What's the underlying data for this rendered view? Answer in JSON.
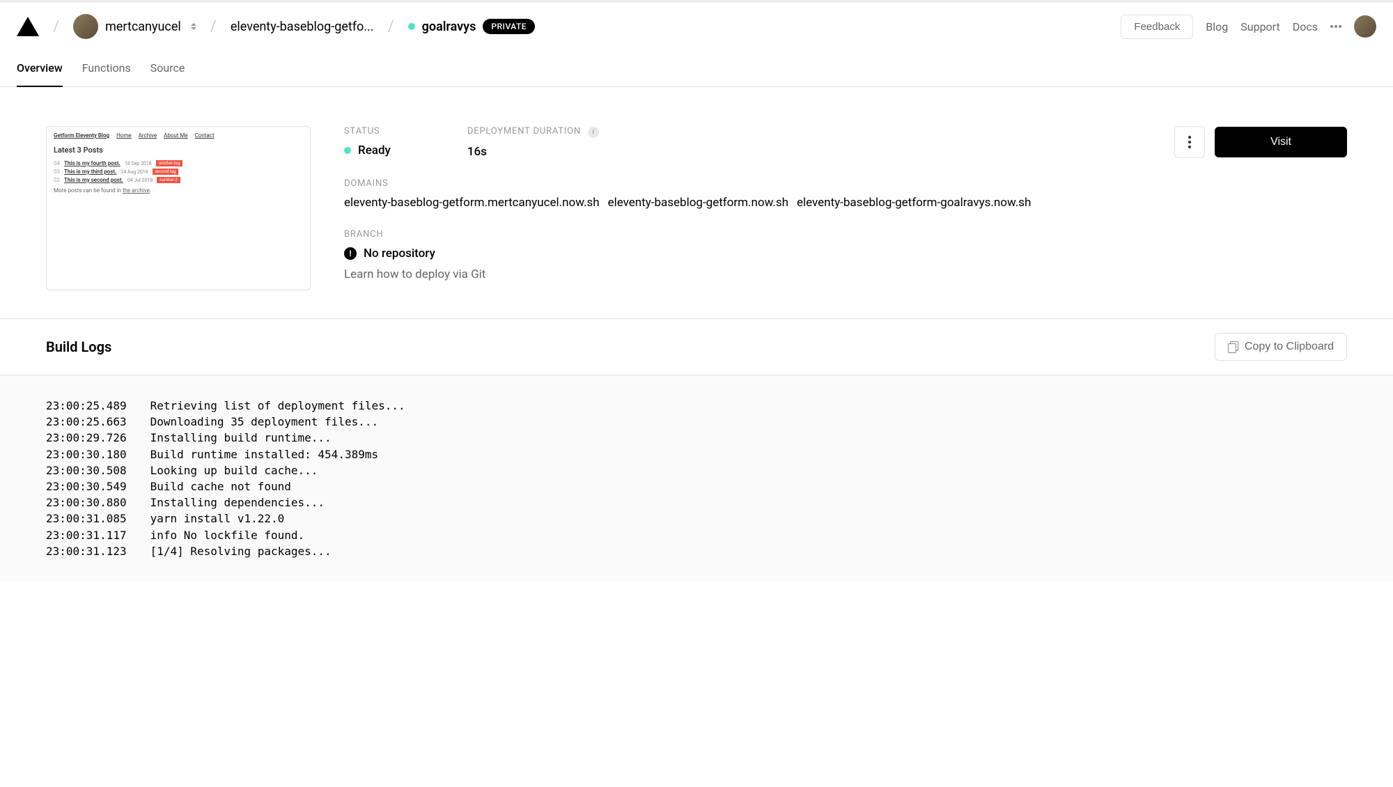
{
  "header": {
    "username": "mertcanyucel",
    "project": "eleventy-baseblog-getfo...",
    "deployment": "goalravys",
    "private_label": "PRIVATE",
    "feedback": "Feedback",
    "links": [
      "Blog",
      "Support",
      "Docs"
    ]
  },
  "tabs": [
    {
      "label": "Overview",
      "active": true
    },
    {
      "label": "Functions",
      "active": false
    },
    {
      "label": "Source",
      "active": false
    }
  ],
  "preview": {
    "site_title": "Getform Eleventy Blog",
    "nav": [
      "Home",
      "Archive",
      "About Me",
      "Contact"
    ],
    "heading": "Latest 3 Posts",
    "posts": [
      {
        "num": "04",
        "title": "This is my fourth post.",
        "date": "18 Sep 2018",
        "tag": "another-tag"
      },
      {
        "num": "03",
        "title": "This is my third post.",
        "date": "24 Aug 2018",
        "tag": "second-tag"
      },
      {
        "num": "02",
        "title": "This is my second post.",
        "date": "04 Jul 2018",
        "tag": "number-2"
      }
    ],
    "footer_text": "More posts can be found in ",
    "footer_link": "the archive"
  },
  "details": {
    "status_label": "STATUS",
    "status_value": "Ready",
    "duration_label": "DEPLOYMENT DURATION",
    "duration_value": "16s",
    "visit": "Visit",
    "domains_label": "DOMAINS",
    "domains": [
      "eleventy-baseblog-getform.mertcanyucel.now.sh",
      "eleventy-baseblog-getform.now.sh",
      "eleventy-baseblog-getform-goalravys.now.sh"
    ],
    "branch_label": "BRANCH",
    "branch_value": "No repository",
    "git_help": "Learn how to deploy via Git"
  },
  "logs": {
    "title": "Build Logs",
    "copy": "Copy to Clipboard",
    "lines": [
      {
        "t": "23:00:25.489",
        "m": "Retrieving list of deployment files..."
      },
      {
        "t": "23:00:25.663",
        "m": "Downloading 35 deployment files..."
      },
      {
        "t": "23:00:29.726",
        "m": "Installing build runtime..."
      },
      {
        "t": "23:00:30.180",
        "m": "Build runtime installed: 454.389ms"
      },
      {
        "t": "23:00:30.508",
        "m": "Looking up build cache..."
      },
      {
        "t": "23:00:30.549",
        "m": "Build cache not found"
      },
      {
        "t": "23:00:30.880",
        "m": "Installing dependencies..."
      },
      {
        "t": "23:00:31.085",
        "m": "yarn install v1.22.0"
      },
      {
        "t": "23:00:31.117",
        "m": "info No lockfile found."
      },
      {
        "t": "23:00:31.123",
        "m": "[1/4] Resolving packages..."
      }
    ]
  }
}
